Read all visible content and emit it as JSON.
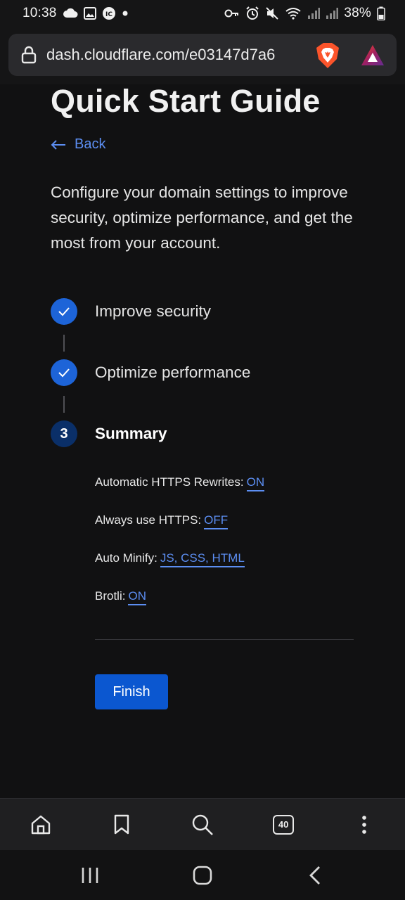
{
  "status_bar": {
    "time": "10:38",
    "battery": "38%",
    "left_icons": [
      "cloud-icon",
      "image-icon",
      "ic-app-icon",
      "dot-icon"
    ],
    "right_icons": [
      "key-icon",
      "alarm-icon",
      "mute-icon",
      "wifi-icon",
      "signal-icon",
      "signal-icon",
      "battery-icon"
    ]
  },
  "browser": {
    "url": "dash.cloudflare.com/e03147d7a6"
  },
  "page": {
    "title": "Quick Start Guide",
    "back_label": "Back",
    "description": "Configure your domain settings to improve security, optimize performance, and get the most from your account."
  },
  "steps": [
    {
      "label": "Improve security",
      "state": "complete"
    },
    {
      "label": "Optimize performance",
      "state": "complete"
    },
    {
      "label": "Summary",
      "state": "current",
      "number": "3"
    }
  ],
  "summary": [
    {
      "label": "Automatic HTTPS Rewrites:",
      "value": "ON"
    },
    {
      "label": "Always use HTTPS:",
      "value": "OFF"
    },
    {
      "label": "Auto Minify:",
      "value": "JS, CSS, HTML"
    },
    {
      "label": "Brotli:",
      "value": "ON"
    }
  ],
  "finish_label": "Finish",
  "toolbar": {
    "tabs_count": "40"
  },
  "colors": {
    "accent": "#5c8ef2",
    "step_complete": "#1d64d8",
    "step_current": "#0a2f68",
    "button": "#0b57d0",
    "background": "#111112"
  }
}
